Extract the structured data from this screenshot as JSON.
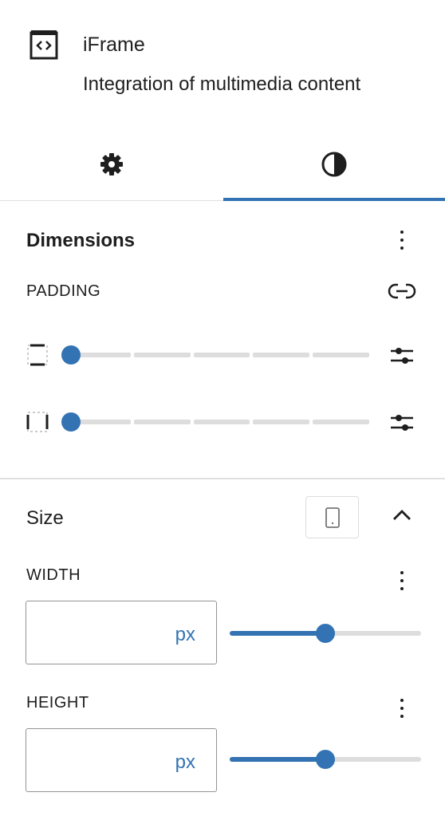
{
  "block": {
    "icon": "embed-code-icon",
    "title": "iFrame",
    "description": "Integration of multimedia content"
  },
  "tabs": [
    {
      "name": "settings",
      "icon": "gear-icon",
      "active": false
    },
    {
      "name": "styles",
      "icon": "contrast-icon",
      "active": true
    }
  ],
  "colors": {
    "accent": "#3373b3",
    "text": "#1e1e1e",
    "border": "#e0e0e0",
    "track": "#dddddd"
  },
  "dimensions": {
    "title": "Dimensions",
    "padding_label": "PADDING",
    "padding_rows": [
      {
        "side": "vertical",
        "icon": "padding-vertical-icon",
        "value_fraction": 0
      },
      {
        "side": "horizontal",
        "icon": "padding-horizontal-icon",
        "value_fraction": 0
      }
    ]
  },
  "size": {
    "title": "Size",
    "device_icon": "mobile-device-icon",
    "width": {
      "label": "WIDTH",
      "value": "",
      "unit": "px",
      "slider_fraction": 0.5
    },
    "height": {
      "label": "HEIGHT",
      "value": "",
      "unit": "px",
      "slider_fraction": 0.5
    }
  }
}
